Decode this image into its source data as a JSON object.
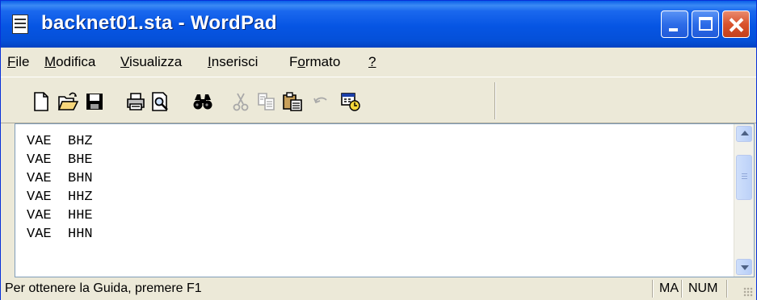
{
  "window": {
    "title": "backnet01.sta - WordPad"
  },
  "menu": [
    {
      "pre": "",
      "u": "F",
      "post": "ile"
    },
    {
      "pre": "",
      "u": "M",
      "post": "odifica"
    },
    {
      "pre": "",
      "u": "V",
      "post": "isualizza"
    },
    {
      "pre": "",
      "u": "I",
      "post": "nserisci"
    },
    {
      "pre": "F",
      "u": "o",
      "post": "rmato"
    },
    {
      "pre": "",
      "u": "?",
      "post": ""
    }
  ],
  "toolbar": {
    "icons": [
      "new-document-icon",
      "open-folder-icon",
      "save-disk-icon",
      "print-icon",
      "print-preview-icon",
      "find-binoculars-icon",
      "cut-scissors-icon",
      "copy-icon",
      "paste-clipboard-icon",
      "undo-icon",
      "insert-date-time-icon"
    ]
  },
  "document": {
    "lines": [
      "VAE  BHZ",
      "VAE  BHE",
      "VAE  BHN",
      "VAE  HHZ",
      "VAE  HHE",
      "VAE  HHN"
    ]
  },
  "status": {
    "help_text": "Per ottenere la Guida, premere F1",
    "caps": "MA",
    "num": "NUM"
  }
}
